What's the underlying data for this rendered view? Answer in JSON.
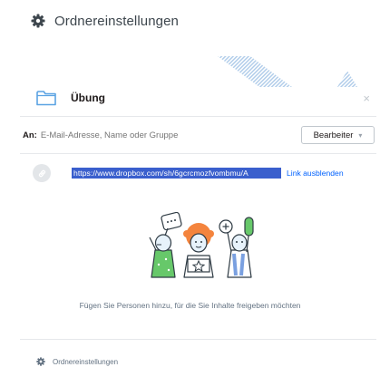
{
  "header": {
    "title": "Ordnereinstellungen",
    "icon": "gear-icon"
  },
  "modal": {
    "folder_icon": "folder-icon",
    "folder_name": "Übung",
    "close_label": "×",
    "to_label": "An:",
    "to_placeholder": "E-Mail-Adresse, Name oder Gruppe",
    "permission_label": "Bearbeiter",
    "permission_caret": "▾",
    "share_link_url": "https://www.dropbox.com/sh/6gcrcmozfvombmu/A",
    "hide_link_label": "Link ausblenden",
    "empty_message": "Fügen Sie Personen hinzu, für die Sie Inhalte freigeben möchten",
    "footer_label": "Ordnereinstellungen"
  },
  "colors": {
    "accent_blue": "#0061fe",
    "selection_blue": "#3a5fcd",
    "folder_blue": "#5ba3e3",
    "stripe_blue": "#aecbe9",
    "illustration_green": "#67c86a",
    "illustration_orange": "#f4843d",
    "illustration_blue": "#7aa0e0"
  }
}
